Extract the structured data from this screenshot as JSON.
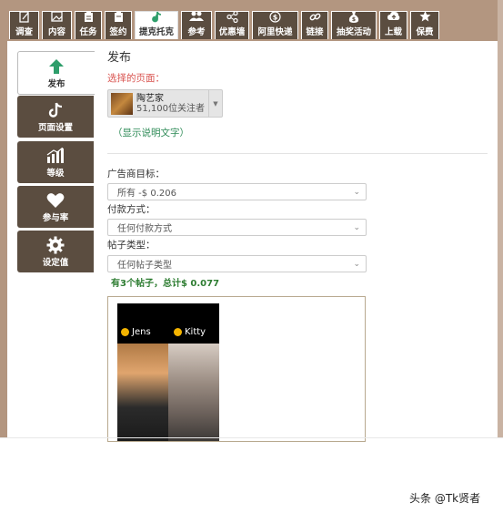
{
  "tabs": [
    {
      "label": "调查",
      "icon": "edit-icon"
    },
    {
      "label": "内容",
      "icon": "image-icon"
    },
    {
      "label": "任务",
      "icon": "clipboard-icon"
    },
    {
      "label": "签约",
      "icon": "contract-icon"
    },
    {
      "label": "提克托克",
      "icon": "tiktok-icon",
      "active": true
    },
    {
      "label": "参考",
      "icon": "users-icon"
    },
    {
      "label": "优惠墙",
      "icon": "share-icon"
    },
    {
      "label": "阿里快递",
      "icon": "dollar-circle-icon"
    },
    {
      "label": "链接",
      "icon": "link-icon"
    },
    {
      "label": "抽奖活动",
      "icon": "money-bag-icon"
    },
    {
      "label": "上载",
      "icon": "upload-icon"
    },
    {
      "label": "保费",
      "icon": "star-icon"
    }
  ],
  "sidebar": {
    "items": [
      {
        "label": "发布",
        "icon": "arrow-up-icon",
        "active": true
      },
      {
        "label": "页面设置",
        "icon": "tiktok-icon"
      },
      {
        "label": "等级",
        "icon": "bar-chart-icon"
      },
      {
        "label": "参与率",
        "icon": "heart-icon"
      },
      {
        "label": "设定值",
        "icon": "gear-icon"
      }
    ]
  },
  "main": {
    "title": "发布",
    "selected_page_label": "选择的页面：",
    "page": {
      "name": "陶艺家",
      "followers": "51,100位关注者"
    },
    "show_description": "（显示说明文字）",
    "advertiser_goal": {
      "label": "广告商目标：",
      "value": "所有 -$ 0.206"
    },
    "payment_method": {
      "label": "付款方式：",
      "value": "任何付款方式"
    },
    "post_type": {
      "label": "帖子类型：",
      "value": "任何帖子类型"
    },
    "summary": "有3个帖子，总计$ 0.077",
    "preview": {
      "user1": "Jens",
      "user2": "Kitty"
    }
  },
  "watermark": "头条 @Tk贤者",
  "colors": {
    "frame": "#b39680",
    "tab_bg": "#5b4d40",
    "accent_green": "#2e9e6b",
    "label_red": "#d9534f",
    "summary_green": "#2e7d32"
  }
}
